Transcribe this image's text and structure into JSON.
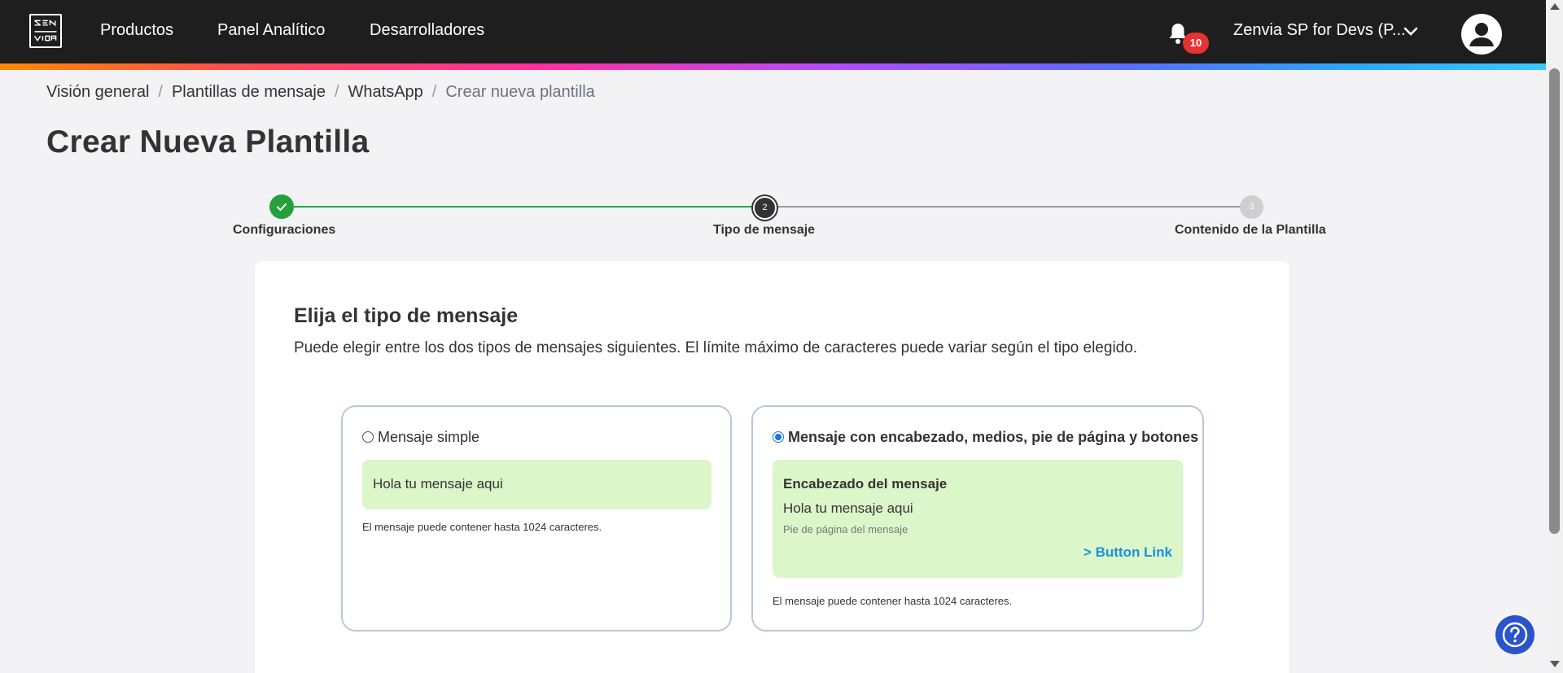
{
  "nav": {
    "items": [
      {
        "label": "Productos"
      },
      {
        "label": "Panel Analítico"
      },
      {
        "label": "Desarrolladores"
      }
    ],
    "notifications_count": "10",
    "account_name": "Zenvia SP for Devs (P...",
    "icons": [
      "zenvia-logo",
      "bell-icon",
      "chevron-down-icon",
      "user-avatar-icon"
    ]
  },
  "breadcrumb": {
    "items": [
      "Visión general",
      "Plantillas de mensaje",
      "WhatsApp"
    ],
    "current": "Crear nueva plantilla",
    "separator": "/"
  },
  "page_title": "Crear Nueva Plantilla",
  "stepper": {
    "steps": [
      {
        "number": "1",
        "label": "Configuraciones",
        "state": "completed"
      },
      {
        "number": "2",
        "label": "Tipo de mensaje",
        "state": "active"
      },
      {
        "number": "3",
        "label": "Contenido de la Plantilla",
        "state": "pending"
      }
    ]
  },
  "card": {
    "title": "Elija el tipo de mensaje",
    "subtitle": "Puede elegir entre los dos tipos de mensajes siguientes. El límite máximo de caracteres puede variar según el tipo elegido.",
    "options": [
      {
        "label": "Mensaje simple",
        "selected": false,
        "preview_body": "Hola tu mensaje aqui",
        "hint": "El mensaje puede contener hasta 1024 caracteres."
      },
      {
        "label": "Mensaje con encabezado, medios, pie de página y botones",
        "selected": true,
        "preview_header": "Encabezado del mensaje",
        "preview_body": "Hola tu mensaje aqui",
        "preview_footer": "Pie de página del mensaje",
        "preview_button": "> Button Link",
        "hint": "El mensaje puede contener hasta 1024 caracteres."
      }
    ]
  },
  "colors": {
    "topbar": "#1e1e1e",
    "step_done": "#25a03c",
    "bubble": "#dbf7c9",
    "link": "#1a8fe0",
    "badge": "#e53232",
    "help_button": "#2a54c9"
  }
}
